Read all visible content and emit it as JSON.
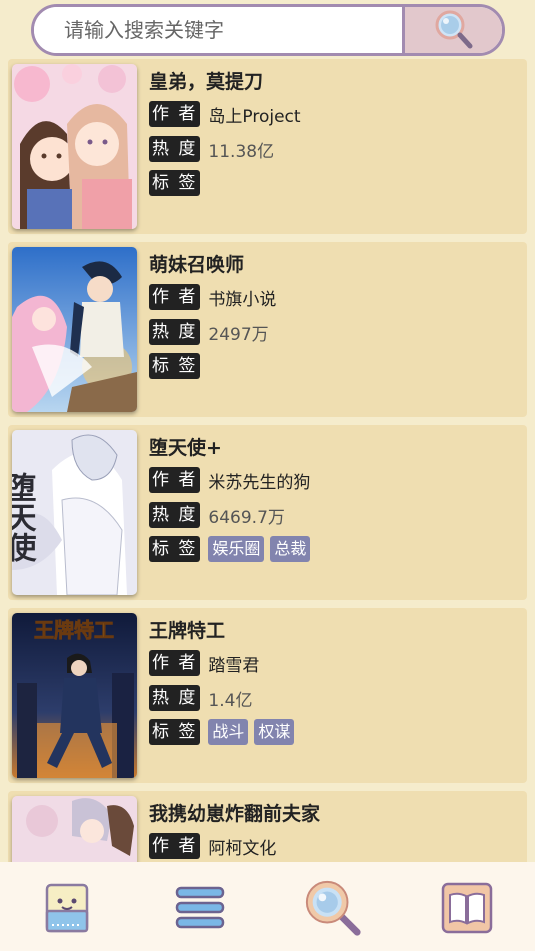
{
  "search": {
    "placeholder": "请输入搜索关键字",
    "button_icon": "magnifier-icon"
  },
  "labels": {
    "author": "作 者",
    "hot": "热 度",
    "tags": "标 签"
  },
  "comics": [
    {
      "title": "皇弟，莫提刀",
      "author": "岛上Project",
      "hot": "11.38亿",
      "tags": []
    },
    {
      "title": "萌妹召唤师",
      "author": "书旗小说",
      "hot": "2497万",
      "tags": []
    },
    {
      "title": "堕天使+",
      "author": "米苏先生的狗",
      "hot": "6469.7万",
      "tags": [
        "娱乐圈",
        "总裁"
      ]
    },
    {
      "title": "王牌特工",
      "author": "踏雪君",
      "hot": "1.4亿",
      "tags": [
        "战斗",
        "权谋"
      ]
    },
    {
      "title": "我携幼崽炸翻前夫家",
      "author": "阿柯文化",
      "hot": "",
      "tags": []
    }
  ],
  "covers": {
    "c3_text": "堕天使",
    "c4_text": "王牌特工"
  },
  "nav": [
    {
      "icon": "mascot-icon"
    },
    {
      "icon": "menu-list-icon"
    },
    {
      "icon": "search-magnifier-icon"
    },
    {
      "icon": "book-icon"
    }
  ],
  "colors": {
    "background": "#f5eccc",
    "card": "#efdeb1",
    "tag": "#8284ae",
    "search_border": "#a28bb0"
  }
}
